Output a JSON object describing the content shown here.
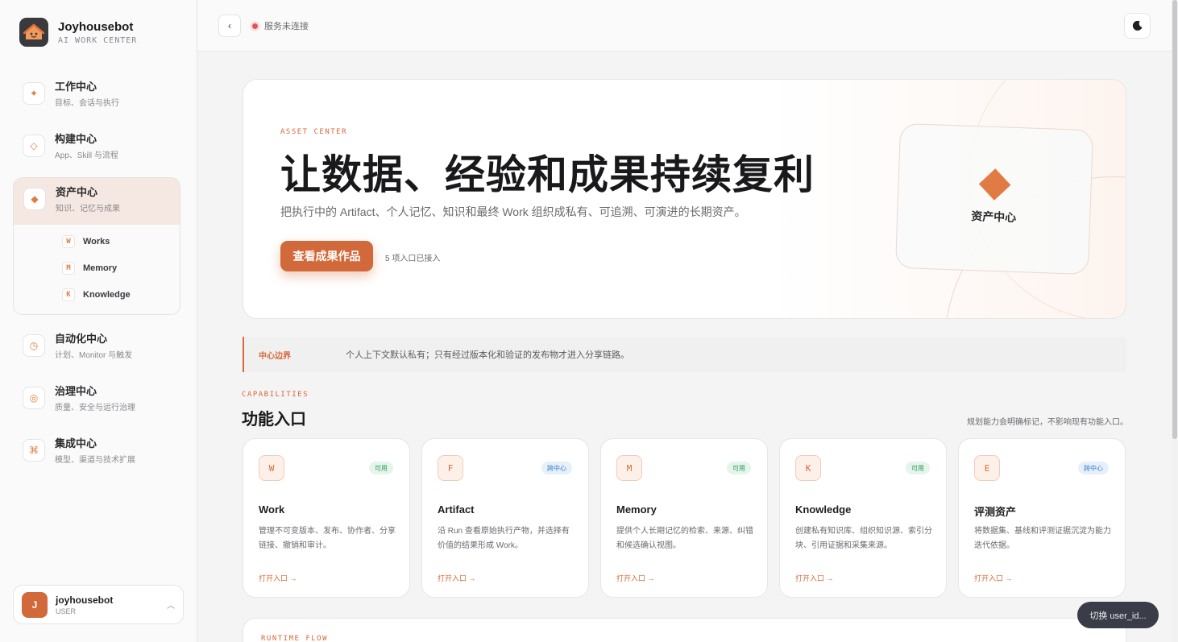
{
  "brand": {
    "name": "Joyhousebot",
    "subtitle": "AI WORK CENTER"
  },
  "nav": {
    "items": [
      {
        "key": "work",
        "icon": "✦",
        "title": "工作中心",
        "desc": "目标、会话与执行"
      },
      {
        "key": "build",
        "icon": "◇",
        "title": "构建中心",
        "desc": "App、Skill 与流程"
      },
      {
        "key": "assets",
        "icon": "◆",
        "title": "资产中心",
        "desc": "知识、记忆与成果"
      },
      {
        "key": "automation",
        "icon": "◷",
        "title": "自动化中心",
        "desc": "计划、Monitor 与触发"
      },
      {
        "key": "governance",
        "icon": "◎",
        "title": "治理中心",
        "desc": "质量、安全与运行治理"
      },
      {
        "key": "integration",
        "icon": "⌘",
        "title": "集成中心",
        "desc": "模型、渠道与技术扩展"
      }
    ],
    "assets_sub": [
      {
        "badge": "W",
        "label": "Works"
      },
      {
        "badge": "M",
        "label": "Memory"
      },
      {
        "badge": "K",
        "label": "Knowledge"
      }
    ]
  },
  "user": {
    "initial": "J",
    "name": "joyhousebot",
    "role": "USER"
  },
  "topbar": {
    "status": "服务未连接"
  },
  "hero": {
    "kicker": "ASSET CENTER",
    "title": "让数据、经验和成果持续复利",
    "desc": "把执行中的 Artifact、个人记忆、知识和最终 Work 组织成私有、可追溯、可演进的长期资产。",
    "cta": "查看成果作品",
    "count": "5 项入口已接入",
    "card_label": "资产中心"
  },
  "boundary": {
    "label": "中心边界",
    "text": "个人上下文默认私有；只有经过版本化和验证的发布物才进入分享链路。"
  },
  "capabilities": {
    "kicker": "CAPABILITIES",
    "title": "功能入口",
    "note": "规划能力会明确标记，不影响现有功能入口。",
    "cards": [
      {
        "badge": "W",
        "tag": "可用",
        "tag_type": "ok",
        "title": "Work",
        "desc": "管理不可变版本、发布、协作者、分享链接、撤销和审计。",
        "link": "打开入口 →"
      },
      {
        "badge": "F",
        "tag": "跨中心",
        "tag_type": "cross",
        "title": "Artifact",
        "desc": "沿 Run 查看原始执行产物，并选择有价值的结果形成 Work。",
        "link": "打开入口 →"
      },
      {
        "badge": "M",
        "tag": "可用",
        "tag_type": "ok",
        "title": "Memory",
        "desc": "提供个人长期记忆的检索、来源、纠错和候选确认视图。",
        "link": "打开入口 →"
      },
      {
        "badge": "K",
        "tag": "可用",
        "tag_type": "ok",
        "title": "Knowledge",
        "desc": "创建私有知识库、组织知识源、索引分块、引用证据和采集来源。",
        "link": "打开入口 →"
      },
      {
        "badge": "E",
        "tag": "跨中心",
        "tag_type": "cross",
        "title": "评测资产",
        "desc": "将数据集、基线和评测证据沉淀为能力迭代依据。",
        "link": "打开入口 →"
      }
    ]
  },
  "runtime": {
    "kicker": "RUNTIME FLOW"
  },
  "switch_pill": "切换 user_id..."
}
